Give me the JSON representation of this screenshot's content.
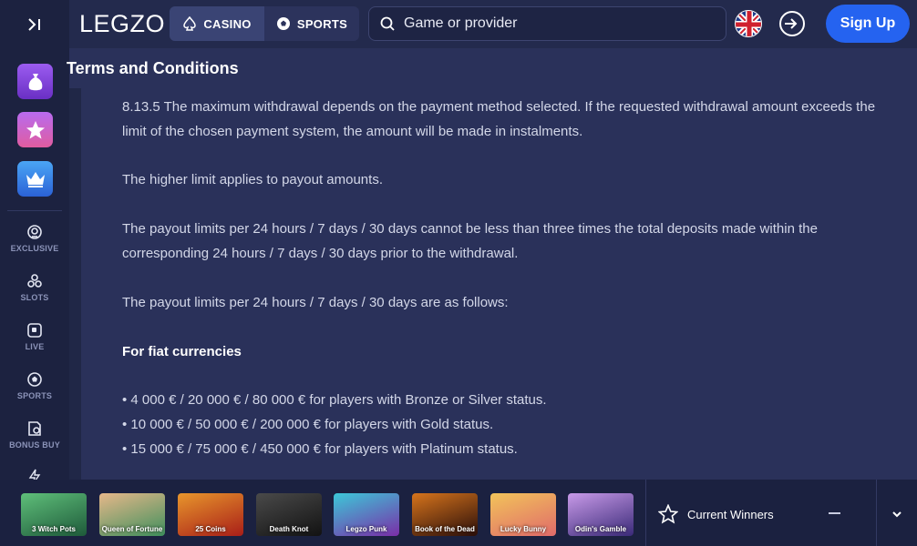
{
  "header": {
    "logo": "LEGZO",
    "tabs": [
      {
        "label": "CASINO",
        "icon": "spade-icon",
        "active": true
      },
      {
        "label": "SPORTS",
        "icon": "football-icon",
        "active": false
      }
    ],
    "search_placeholder": "Game or provider",
    "language_icon": "uk-flag-icon",
    "signup_label": "Sign Up"
  },
  "sidebar": {
    "promos": [
      {
        "icon": "money-bag-icon"
      },
      {
        "icon": "star-icon"
      },
      {
        "icon": "crown-icon"
      }
    ],
    "items": [
      {
        "label": "EXCLUSIVE",
        "icon": "exclusive-icon"
      },
      {
        "label": "SLOTS",
        "icon": "slots-icon"
      },
      {
        "label": "LIVE",
        "icon": "live-icon"
      },
      {
        "label": "SPORTS",
        "icon": "football-icon"
      },
      {
        "label": "BONUS BUY",
        "icon": "bonus-buy-icon"
      }
    ]
  },
  "page": {
    "title": "Terms and Conditions",
    "paragraphs": [
      "8.13.5 The maximum withdrawal depends on the payment method selected. If the requested withdrawal amount exceeds the limit of the chosen payment system, the amount will be made in instalments.",
      "The higher limit applies to payout amounts.",
      "The payout limits per 24 hours / 7 days / 30 days cannot be less than three times the total deposits made within the corresponding 24 hours / 7 days / 30 days prior to the withdrawal.",
      "The payout limits per 24 hours / 7 days / 30 days are as follows:",
      "For fiat currencies",
      "• 4 000 € / 20 000 € / 80 000 € for players with Bronze or Silver status.",
      "• 10 000 € / 50 000 € / 200 000 € for players with Gold status.",
      "• 15 000 € / 75 000 € / 450 000 € for players with Platinum status."
    ]
  },
  "bottom_bar": {
    "games": [
      {
        "title": "3 Witch Pots",
        "color": "#2f7a4a"
      },
      {
        "title": "Queen of Fortune",
        "color": "#4aa06a"
      },
      {
        "title": "25 Coins",
        "color": "#c0421e"
      },
      {
        "title": "Death Knot",
        "color": "#2a2a2a"
      },
      {
        "title": "Legzo Punk",
        "color": "#5a2e8a"
      },
      {
        "title": "Book of the Dead",
        "color": "#3b1a14"
      },
      {
        "title": "Lucky Bunny",
        "color": "#e8a640"
      },
      {
        "title": "Odin's Gamble",
        "color": "#7a4aa8"
      }
    ],
    "winners_label": "Current Winners"
  }
}
